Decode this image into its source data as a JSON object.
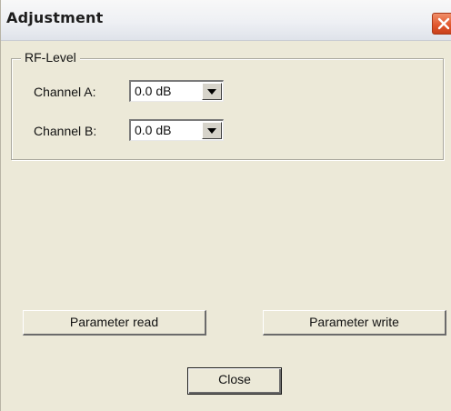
{
  "window": {
    "title": "Adjustment",
    "close_icon": "close-icon"
  },
  "rf_level": {
    "legend": "RF-Level",
    "channel_a": {
      "label": "Channel A:",
      "value": "0.0 dB"
    },
    "channel_b": {
      "label": "Channel B:",
      "value": "0.0 dB"
    }
  },
  "buttons": {
    "parameter_read": "Parameter read",
    "parameter_write": "Parameter write",
    "close": "Close"
  }
}
